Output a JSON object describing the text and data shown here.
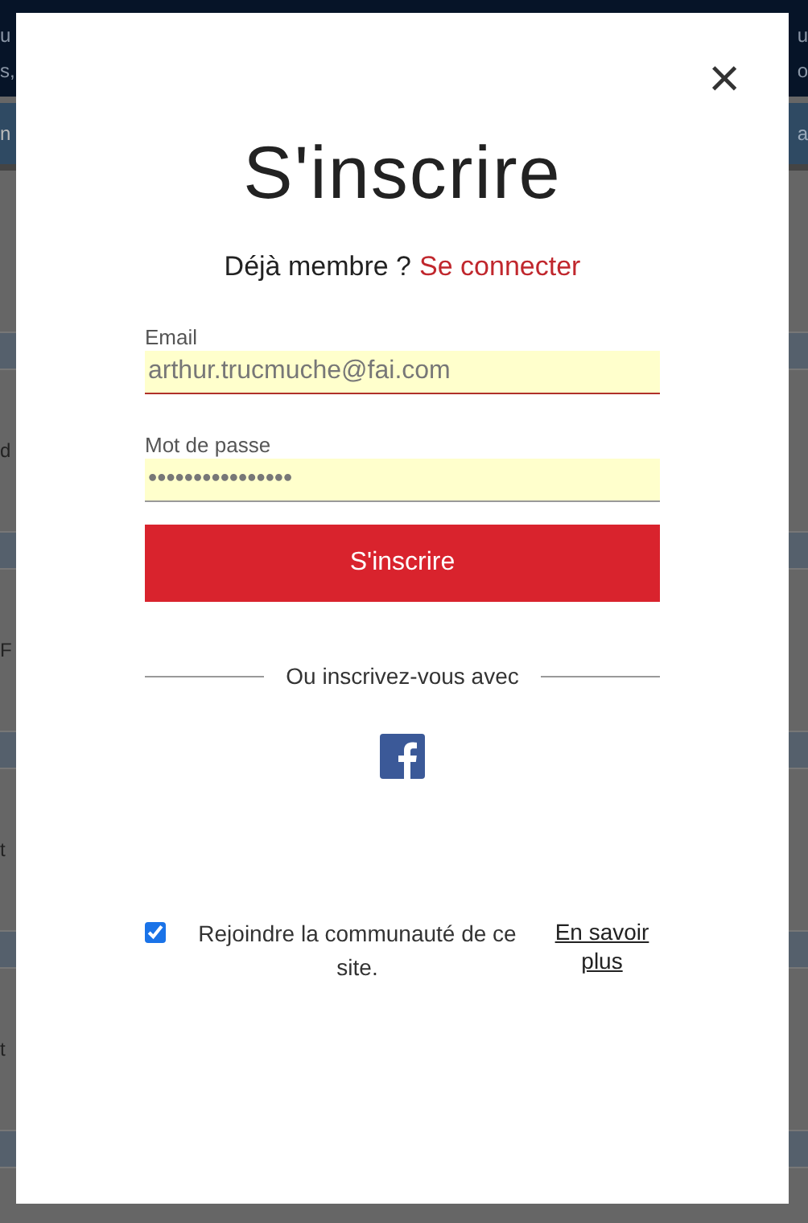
{
  "background": {
    "header_lines": [
      {
        "left": "u",
        "right": "u"
      },
      {
        "left": "s,",
        "right": "o"
      }
    ],
    "bar": {
      "left": "n",
      "right": "a"
    },
    "sections": [
      {
        "left": "d"
      },
      {
        "left": "F"
      },
      {
        "left": "t"
      },
      {
        "left": "t"
      }
    ]
  },
  "dialog": {
    "close": "×",
    "title": "S'inscrire",
    "subtitle": {
      "text": "Déjà membre ?",
      "link": "Se connecter"
    },
    "fields": [
      {
        "label": "Email",
        "value": "arthur.trucmuche@fai.com",
        "focused": true
      },
      {
        "label": "Mot de passe",
        "value": "••••••••••••••••",
        "focused": false
      }
    ],
    "submit": "S'inscrire",
    "divider": "Ou inscrivez-vous avec",
    "social": [
      {
        "kind": "facebook"
      }
    ],
    "community": {
      "label": "Rejoindre la communauté de ce site.",
      "checked": true
    },
    "learn_more": "En savoir plus"
  }
}
